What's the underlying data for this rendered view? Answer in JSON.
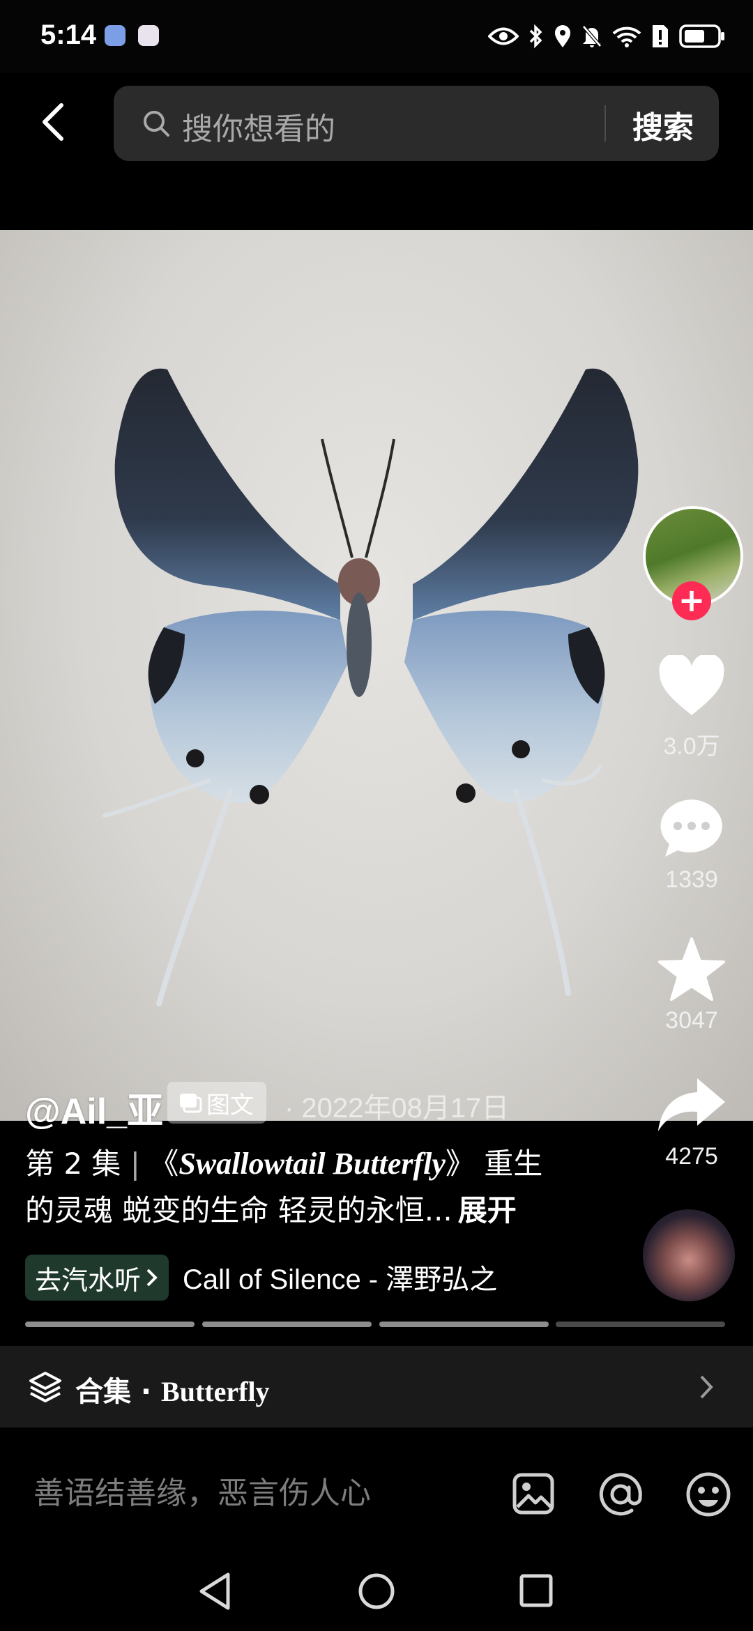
{
  "status_bar": {
    "time": "5:14"
  },
  "search": {
    "placeholder": "搜你想看的",
    "button_label": "搜索"
  },
  "post": {
    "author": "@Ail_亚",
    "type_tag": "图文",
    "date": "· 2022年08月17日",
    "caption_episode": "第 2 集",
    "caption_title": "Swallowtail Butterfly",
    "caption_text": "重生",
    "caption_line2": "的灵魂 蜕变的生命 轻灵的永恒...",
    "expand_label": "展开"
  },
  "actions": {
    "likes": "3.0万",
    "comments": "1339",
    "favorites": "3047",
    "shares": "4275"
  },
  "music": {
    "button_label": "去汽水听",
    "title": "Call of Silence - 澤野弘之"
  },
  "image_pager": {
    "pages": 4,
    "current": 1
  },
  "collection": {
    "label": "合集",
    "name": "Butterfly"
  },
  "comment": {
    "placeholder": "善语结善缘，恶言伤人心"
  },
  "colors": {
    "follow_accent": "#fe2c55",
    "music_button": "#1f3a2c"
  }
}
